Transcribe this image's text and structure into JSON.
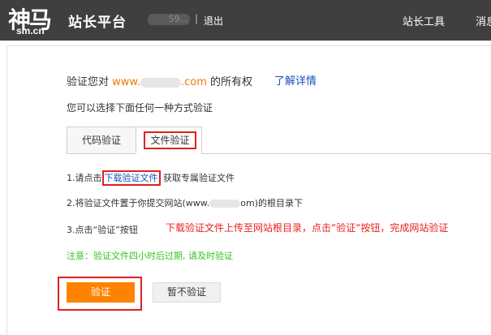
{
  "header": {
    "logo_main": "神马",
    "logo_sub": "sm.cn",
    "site_title": "站长平台",
    "user_name": "59...",
    "separator": "|",
    "logout_label": "退出",
    "nav_tools": "站长工具",
    "nav_messages": "消息"
  },
  "main": {
    "verify_prefix": "验证您对",
    "domain_prefix": "www.",
    "domain_suffix": ".com",
    "verify_suffix": "的所有权",
    "learn_more": "了解详情",
    "choose_text": "您可以选择下面任何一种方式验证",
    "tabs": [
      {
        "label": "代码验证"
      },
      {
        "label": "文件验证"
      }
    ],
    "steps": {
      "step1_prefix": "1.请点击",
      "step1_link": "下载验证文件",
      "step1_suffix": "获取专属验证文件",
      "step2_prefix": "2.将验证文件置于你提交网站(www.",
      "step2_suffix": "om)的根目录下",
      "step3": "3.点击“验证”按钮"
    },
    "hint_red": "下载验证文件上传至网站根目录，点击“验证“按钮，完成网站验证",
    "note_green": "注意：验证文件四小时后过期, 请及时验证",
    "verify_button": "验证",
    "skip_button": "暂不验证"
  },
  "colors": {
    "header_bg": "#3f3f3f",
    "accent_orange": "#ff8200",
    "link_blue": "#1c4fbf",
    "highlight_red": "#e02020",
    "note_green": "#36c420"
  }
}
